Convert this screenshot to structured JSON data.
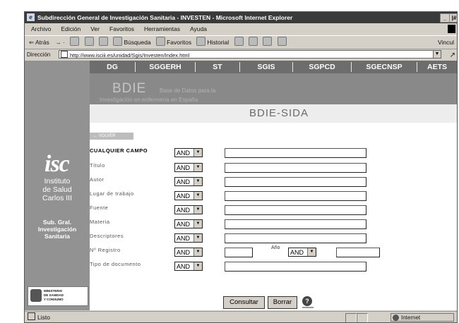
{
  "window": {
    "title": "Subdirección General de Investigación Sanitaria - INVESTEN - Microsoft Internet Explorer",
    "minimize": "_",
    "close": "|#"
  },
  "menu": [
    "Archivo",
    "Edición",
    "Ver",
    "Favoritos",
    "Herramientas",
    "Ayuda"
  ],
  "toolbar": {
    "back": "⇐ Atrás",
    "forward": "→ ·",
    "search": "Búsqueda",
    "favorites": "Favoritos",
    "history": "Historial",
    "right_text": "Vincul"
  },
  "address": {
    "label": "Dirección",
    "url": "http://www.isciii.es/unidad/Sgis/Investen/Index.html",
    "go": "↗"
  },
  "nav": [
    "DG",
    "SGGERH",
    "ST",
    "SGIS",
    "SGPCD",
    "SGECNSP",
    "AETS"
  ],
  "sidebar": {
    "logo": "isc",
    "institute": [
      "Instituto",
      "de Salud",
      "Carlos III"
    ],
    "subgral": [
      "Sub. Gral.",
      "Investigación",
      "Sanitaria"
    ],
    "ministry": [
      "MINISTERIO",
      "DE SANIDAD",
      "Y CONSUMO"
    ]
  },
  "banner": {
    "title": "BDIE",
    "tagline_line1": "Base de Datos para la",
    "tagline_line2": "Investigación en enfermería en España",
    "sida": "BDIE-SIDA",
    "volver": "← VOLVER"
  },
  "form": {
    "rows": [
      {
        "label": "CUALQUIER CAMPO",
        "operator": "AND"
      },
      {
        "label": "Título",
        "operator": "AND"
      },
      {
        "label": "Autor",
        "operator": "AND"
      },
      {
        "label": "Lugar de trabajo",
        "operator": "AND"
      },
      {
        "label": "Fuente",
        "operator": "AND"
      },
      {
        "label": "Materia",
        "operator": "AND"
      },
      {
        "label": "Descriptores",
        "operator": "AND"
      },
      {
        "label": "Nº Registro",
        "operator": "AND"
      },
      {
        "label": "Tipo de documento",
        "operator": "AND"
      }
    ],
    "ano_label": "Año",
    "ano_operator": "AND",
    "consultar": "Consultar",
    "borrar": "Borrar",
    "help": "?"
  },
  "status": {
    "text": "Listo",
    "zone": "Internet"
  }
}
